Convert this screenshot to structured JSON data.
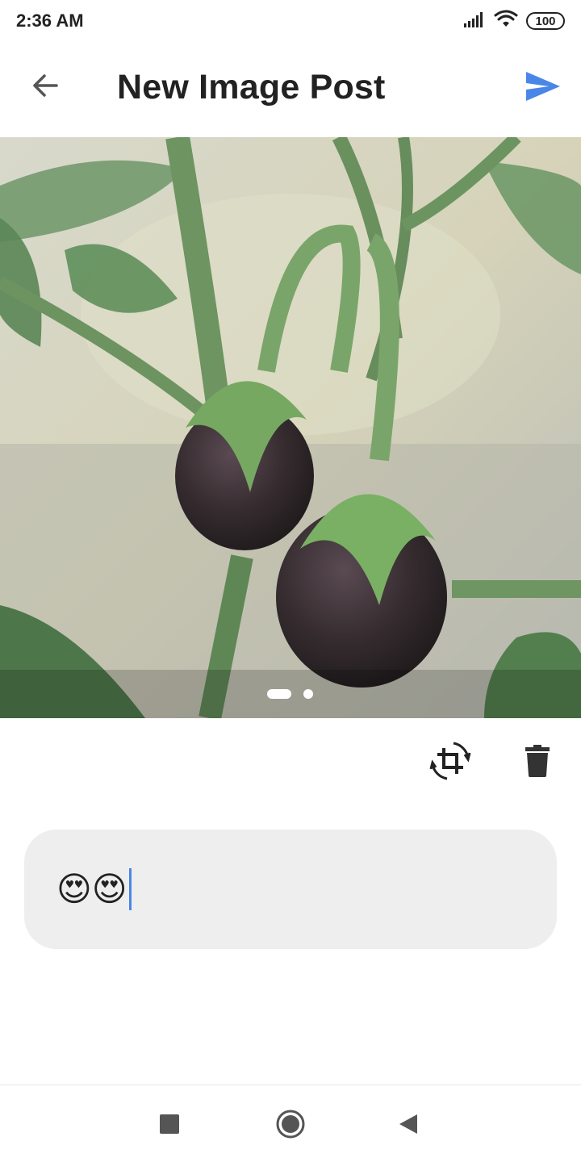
{
  "status_bar": {
    "time": "2:36 AM",
    "battery_level": "100",
    "icons": [
      "signal-icon",
      "wifi-icon",
      "battery-icon"
    ]
  },
  "app_bar": {
    "title": "New Image Post",
    "back_icon": "arrow-left-icon",
    "send_icon": "send-icon",
    "send_color": "#4a86e8"
  },
  "image_pager": {
    "page_count": 2,
    "current_page": 1
  },
  "image_tools": {
    "icons": [
      "crop-rotate-icon",
      "delete-icon"
    ]
  },
  "caption": {
    "value": "😍😍"
  },
  "nav_bar": {
    "icons": [
      "recents-icon",
      "home-icon",
      "back-icon"
    ]
  }
}
